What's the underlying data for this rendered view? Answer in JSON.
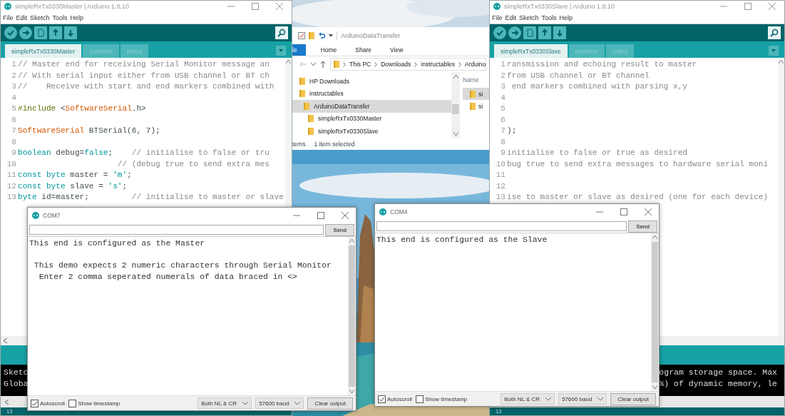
{
  "explorer": {
    "title": "ArduinoDataTransfer",
    "ribbon_tabs": [
      {
        "label": "le",
        "selected": true
      },
      {
        "label": "Home",
        "selected": false
      },
      {
        "label": "Share",
        "selected": false
      },
      {
        "label": "View",
        "selected": false
      }
    ],
    "breadcrumbs": [
      "This PC",
      "Downloads",
      "instructables",
      "Arduino"
    ],
    "nav_items": [
      {
        "label": "HP Downloads",
        "selected": false
      },
      {
        "label": "instructables",
        "selected": false,
        "children": [
          {
            "label": "ArduinoDataTransfer",
            "selected": true,
            "children": [
              {
                "label": "simpleRxTx0330Master",
                "selected": false
              },
              {
                "label": "simpleRxTx0330Slave",
                "selected": false
              }
            ]
          }
        ]
      }
    ],
    "column_header": "Name",
    "files": [
      {
        "name": "si",
        "selected": true
      },
      {
        "name": "si",
        "selected": false
      }
    ],
    "status": [
      "tems",
      "1 item selected"
    ]
  },
  "ide_windows": [
    {
      "title": "simpleRxTx0330Master | Arduino 1.8.10",
      "menu": [
        "File",
        "Edit",
        "Sketch",
        "Tools",
        "Help"
      ],
      "tabs": [
        {
          "label": "simpleRxTx0330Master",
          "selected": true
        },
        {
          "label": "common",
          "selected": false
        },
        {
          "label": "notes",
          "selected": false
        }
      ],
      "code_lines": [
        {
          "number": "1",
          "segments": [
            {
              "kind": "comment",
              "text": "// Master end for receiving Serial Monitor message an"
            }
          ]
        },
        {
          "number": "2",
          "segments": [
            {
              "kind": "comment",
              "text": "// With serial input either from USB channel or BT ch"
            }
          ]
        },
        {
          "number": "3",
          "segments": [
            {
              "kind": "comment",
              "text": "//    Receive with start and end markers combined with"
            }
          ]
        },
        {
          "number": "4"
        },
        {
          "number": "5",
          "segments": [
            {
              "kind": "preproc",
              "text": "#include"
            },
            {
              "kind": "plain",
              "text": " <"
            },
            {
              "kind": "class",
              "text": "SoftwareSerial"
            },
            {
              "kind": "plain",
              "text": ".h>"
            }
          ]
        },
        {
          "number": "6"
        },
        {
          "number": "7",
          "segments": [
            {
              "kind": "class",
              "text": "SoftwareSerial"
            },
            {
              "kind": "plain",
              "text": " BTSerial(6, 7);"
            }
          ]
        },
        {
          "number": "8"
        },
        {
          "number": "9",
          "segments": [
            {
              "kind": "keyword",
              "text": "boolean"
            },
            {
              "kind": "plain",
              "text": " debug="
            },
            {
              "kind": "keyword",
              "text": "false"
            },
            {
              "kind": "plain",
              "text": ";    "
            },
            {
              "kind": "comment",
              "text": "// initialise to false or tru"
            }
          ]
        },
        {
          "number": "10",
          "segments": [
            {
              "kind": "comment",
              "text": "                     // (debug true to send extra mes"
            }
          ]
        },
        {
          "number": "11",
          "segments": [
            {
              "kind": "keyword",
              "text": "const byte"
            },
            {
              "kind": "plain",
              "text": " master = "
            },
            {
              "kind": "string",
              "text": "'m'"
            },
            {
              "kind": "plain",
              "text": ";"
            }
          ]
        },
        {
          "number": "12",
          "segments": [
            {
              "kind": "keyword",
              "text": "const byte"
            },
            {
              "kind": "plain",
              "text": " slave = "
            },
            {
              "kind": "string",
              "text": "'s'"
            },
            {
              "kind": "plain",
              "text": ";"
            }
          ]
        },
        {
          "number": "13",
          "segments": [
            {
              "kind": "keyword",
              "text": "byte"
            },
            {
              "kind": "plain",
              "text": " id=master;         "
            },
            {
              "kind": "comment",
              "text": "// initialise to master or slave"
            }
          ]
        }
      ],
      "console_lines": [
        "Sketc",
        "Globa"
      ],
      "status": {
        "line": "13"
      }
    },
    {
      "title": "simpleRxTx0330Slave | Arduino 1.8.10",
      "menu": [
        "File",
        "Edit",
        "Sketch",
        "Tools",
        "Help"
      ],
      "tabs": [
        {
          "label": "simpleRxTx0330Slave",
          "selected": true
        },
        {
          "label": "common",
          "selected": false
        },
        {
          "label": "notes",
          "selected": false
        }
      ],
      "code_lines": [
        {
          "number": "1",
          "segments": [
            {
              "kind": "comment",
              "text": "ransmission and echoing result to master"
            }
          ]
        },
        {
          "number": "2",
          "segments": [
            {
              "kind": "comment",
              "text": "from USB channel or BT channel"
            }
          ]
        },
        {
          "number": "3",
          "segments": [
            {
              "kind": "comment",
              "text": " end markers combined with parsing x,y"
            }
          ]
        },
        {
          "number": "4"
        },
        {
          "number": "5"
        },
        {
          "number": "6"
        },
        {
          "number": "7",
          "segments": [
            {
              "kind": "plain",
              "text": ");"
            }
          ]
        },
        {
          "number": "8"
        },
        {
          "number": "9",
          "segments": [
            {
              "kind": "comment",
              "text": "initialise to false or true as desired"
            }
          ]
        },
        {
          "number": "10",
          "segments": [
            {
              "kind": "comment",
              "text": "bug true to send extra messages to hardware serial moni"
            }
          ]
        },
        {
          "number": "11"
        },
        {
          "number": "12"
        },
        {
          "number": "13",
          "segments": [
            {
              "kind": "comment",
              "text": "ise to master or slave as desired (one for each device)"
            }
          ]
        }
      ],
      "console_lines": [
        "ogram storage space. Max",
        "%) of dynamic memory, le"
      ],
      "status": {
        "line": "13"
      }
    }
  ],
  "serial_monitors": [
    {
      "title": "COM7",
      "send_button": "Send",
      "output": [
        [
          "This end is configured as the Master"
        ],
        [
          " This demo expects 2 numeric characters through Serial Monitor",
          "  Enter 2 comma seperated numerals of data braced in <>"
        ]
      ],
      "options": [
        {
          "label": "Autoscroll",
          "checked": true
        },
        {
          "label": "Show timestamp",
          "checked": false
        }
      ],
      "line_ending": "Both NL & CR",
      "baud": "57600 baud",
      "clear_button": "Clear output"
    },
    {
      "title": "COM4",
      "send_button": "Send",
      "output": [
        [
          "This end is configured as the Slave"
        ]
      ],
      "options": [
        {
          "label": "Autoscroll",
          "checked": true
        },
        {
          "label": "Show timestamp",
          "checked": false
        }
      ],
      "line_ending": "Both NL & CR",
      "baud": "57600 baud",
      "clear_button": "Clear output"
    }
  ]
}
